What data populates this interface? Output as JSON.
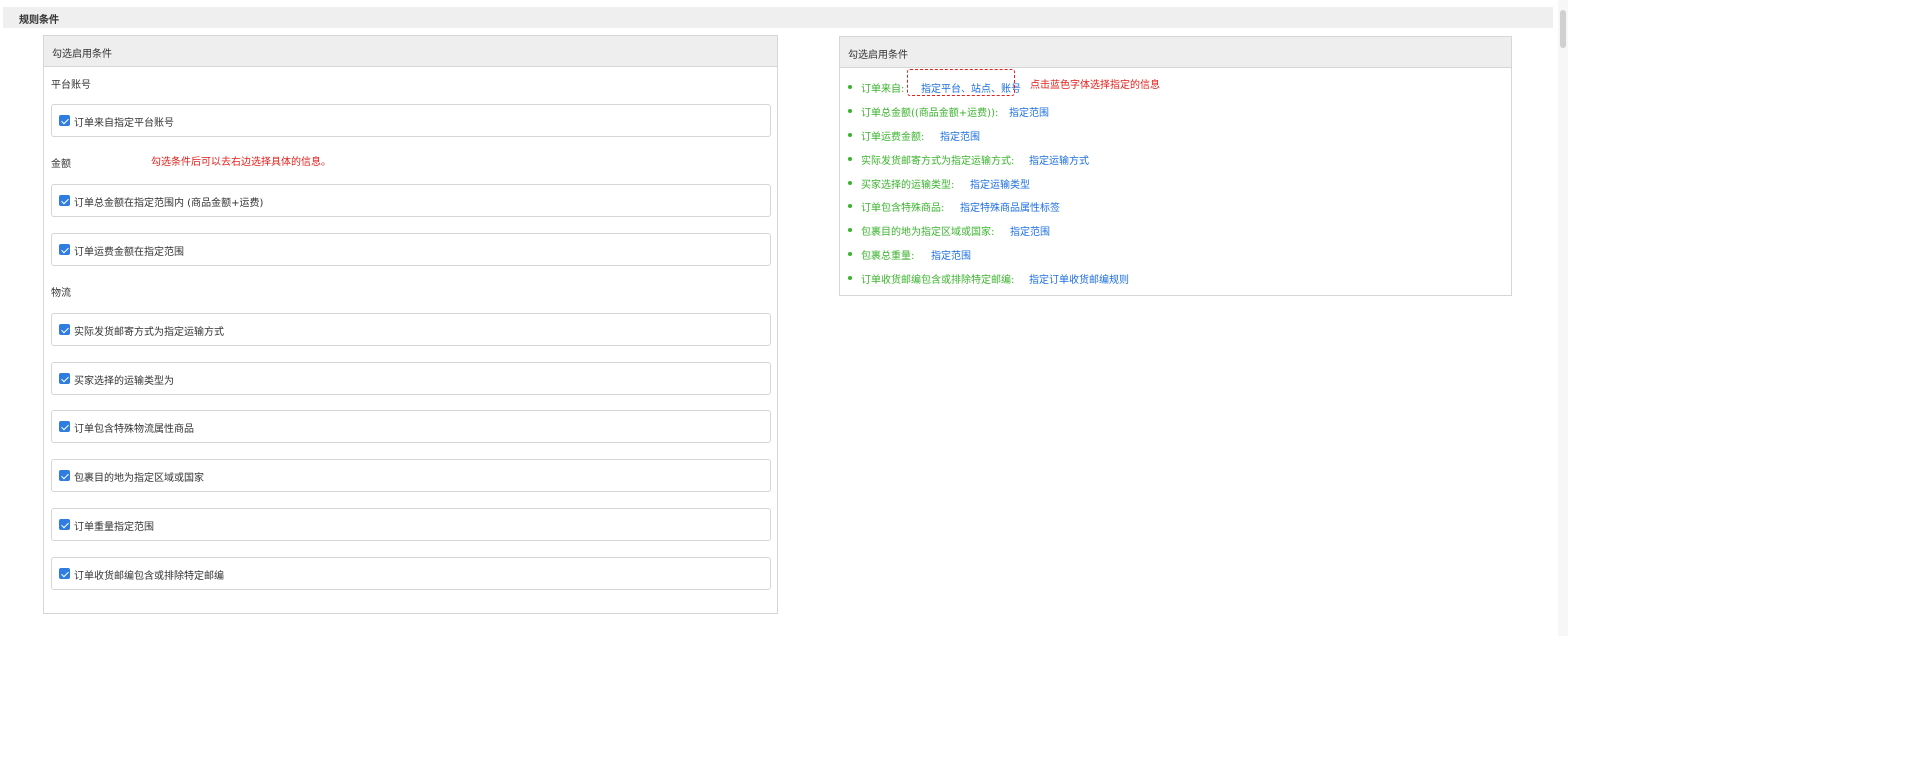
{
  "section": {
    "title": "规则条件"
  },
  "left_panel": {
    "header": "勾选启用条件",
    "groups": {
      "platform": {
        "label": "平台账号"
      },
      "amount": {
        "label": "金额",
        "note": "勾选条件后可以去右边选择具体的信息。"
      },
      "logistics": {
        "label": "物流"
      }
    },
    "options": [
      {
        "label": "订单来自指定平台账号",
        "checked": true
      },
      {
        "label": "订单总金额在指定范围内 (商品金额+运费)",
        "checked": true
      },
      {
        "label": "订单运费金额在指定范围",
        "checked": true
      },
      {
        "label": "实际发货邮寄方式为指定运输方式",
        "checked": true
      },
      {
        "label": "买家选择的运输类型为",
        "checked": true
      },
      {
        "label": "订单包含特殊物流属性商品",
        "checked": true
      },
      {
        "label": "包裹目的地为指定区域或国家",
        "checked": true
      },
      {
        "label": "订单重量指定范围",
        "checked": true
      },
      {
        "label": "订单收货邮编包含或排除特定邮编",
        "checked": true
      }
    ]
  },
  "right_panel": {
    "header": "勾选启用条件",
    "note": "点击蓝色字体选择指定的信息",
    "conditions": [
      {
        "label": "订单来自:",
        "link": "指定平台、站点、账号"
      },
      {
        "label": "订单总金额((商品金额+运费)):",
        "link": "指定范围"
      },
      {
        "label": "订单运费金额:",
        "link": "指定范围"
      },
      {
        "label": "实际发货邮寄方式为指定运输方式:",
        "link": "指定运输方式"
      },
      {
        "label": "买家选择的运输类型:",
        "link": "指定运输类型"
      },
      {
        "label": "订单包含特殊商品:",
        "link": "指定特殊商品属性标签"
      },
      {
        "label": "包裹目的地为指定区域或国家:",
        "link": "指定范围"
      },
      {
        "label": "包裹总重量:",
        "link": "指定范围"
      },
      {
        "label": "订单收货邮编包含或排除特定邮编:",
        "link": "指定订单收货邮编规则"
      }
    ]
  },
  "colors": {
    "condition_label": "#3bb32d",
    "link": "#1e6fe0",
    "annotation": "#e0201b",
    "checkbox": "#2f7de1"
  }
}
